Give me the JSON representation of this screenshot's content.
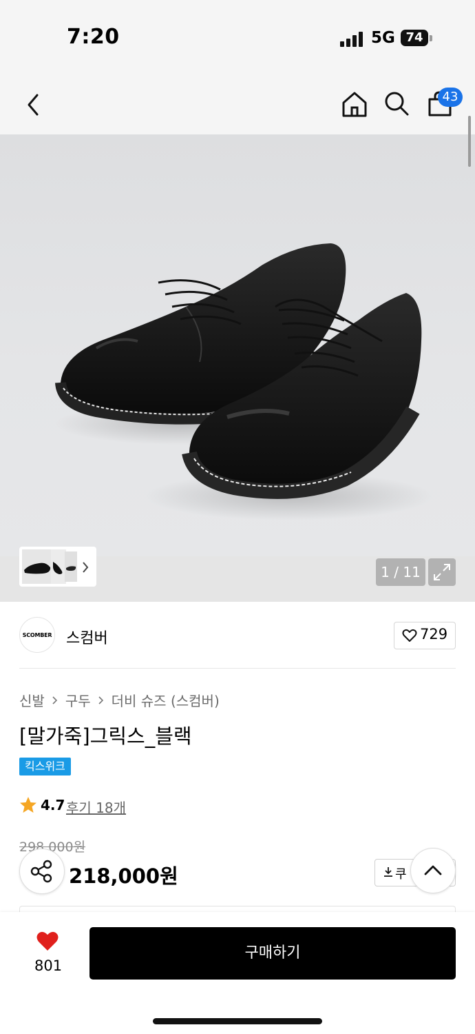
{
  "status_bar": {
    "time": "7:20",
    "network": "5G",
    "battery": "74"
  },
  "nav": {
    "cart_count": "43"
  },
  "gallery": {
    "counter": "1 / 11"
  },
  "brand": {
    "logo_text": "SCOMBER",
    "name": "스컴버",
    "like_count": "729"
  },
  "breadcrumb": [
    "신발",
    "구두",
    "더비 슈즈 (스컴버)"
  ],
  "product": {
    "title": "[말가죽]그릭스_블랙",
    "tag": "킥스위크",
    "rating": "4.7",
    "reviews_label": "후기 18개",
    "original_price": "298,000원",
    "price": "218,000원"
  },
  "coupon": {
    "label": "쿠"
  },
  "bottom_bar": {
    "wish_count": "801",
    "buy_label": "구매하기"
  },
  "colors": {
    "accent_blue": "#1a73e8",
    "tag_blue": "#1a9be6",
    "wish_red": "#e0201c",
    "star": "#f5a623",
    "buy_bg": "#000000"
  },
  "icons": [
    "back-icon",
    "home-icon",
    "search-icon",
    "bag-icon",
    "expand-icon",
    "heart-icon",
    "star-icon",
    "share-icon",
    "download-icon",
    "chevron-up-icon",
    "chevron-right-icon"
  ]
}
